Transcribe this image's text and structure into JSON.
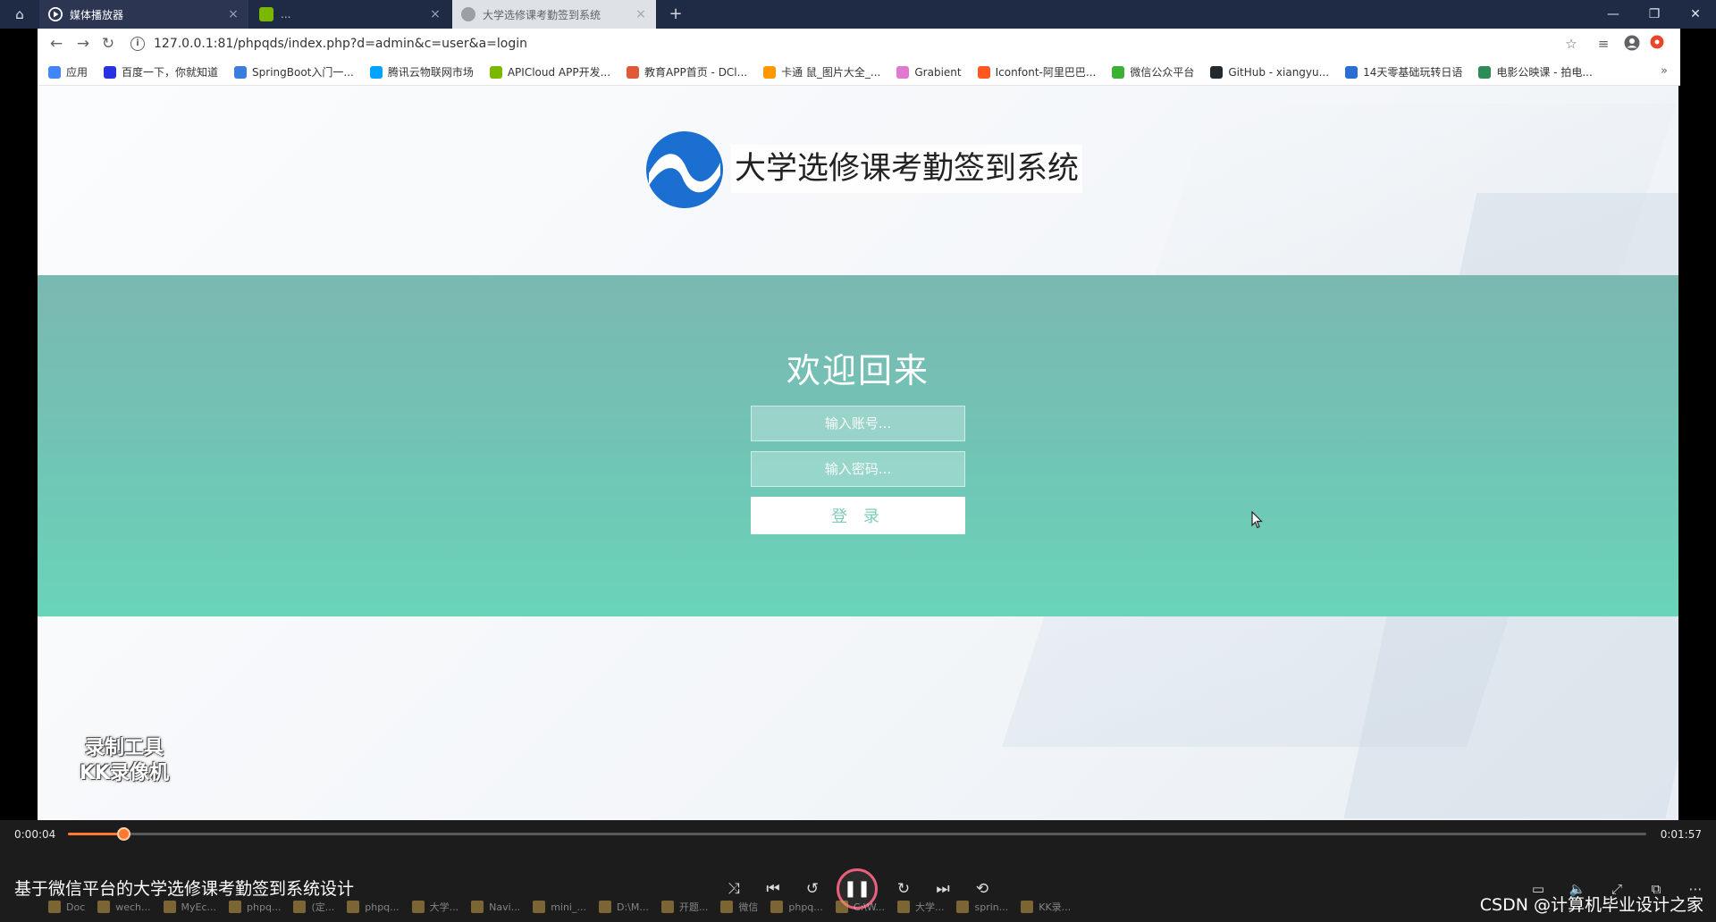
{
  "browser": {
    "tabs": [
      {
        "label": "媒体播放器",
        "active": false
      },
      {
        "label": "..."
      },
      {
        "label": "大学选修课考勤签到系统",
        "active": true
      }
    ],
    "address": "127.0.0.1:81/phpqds/index.php?d=admin&c=user&a=login",
    "bookmarks": [
      {
        "label": "应用",
        "color": "#4285f4"
      },
      {
        "label": "百度一下，你就知道",
        "color": "#2932e1"
      },
      {
        "label": "SpringBoot入门一...",
        "color": "#3b7ddd"
      },
      {
        "label": "腾讯云物联网市场",
        "color": "#00a4ff"
      },
      {
        "label": "APICloud APP开发...",
        "color": "#7ab800"
      },
      {
        "label": "教育APP首页 - DCl...",
        "color": "#e05a3a"
      },
      {
        "label": "卡通 鼠_图片大全_...",
        "color": "#ff9800"
      },
      {
        "label": "Grabient",
        "color": "#e07ad0"
      },
      {
        "label": "Iconfont-阿里巴巴...",
        "color": "#ff5722"
      },
      {
        "label": "微信公众平台",
        "color": "#3cb034"
      },
      {
        "label": "GitHub - xiangyu...",
        "color": "#24292e"
      },
      {
        "label": "14天零基础玩转日语",
        "color": "#2b6fd6"
      },
      {
        "label": "电影公映课 - 拍电...",
        "color": "#2e8b57"
      }
    ]
  },
  "page": {
    "site_title": "大学选修课考勤签到系统",
    "welcome": "欢迎回来",
    "account_placeholder": "输入账号...",
    "password_placeholder": "输入密码...",
    "login_label": "登 录",
    "watermark_line1": "录制工具",
    "watermark_line2": "KK录像机",
    "brand_color": "#1a6fd1",
    "banner_color": "#71c4b5"
  },
  "player": {
    "current_time": "0:00:04",
    "total_time": "0:01:57",
    "progress": 0.035,
    "title": "基于微信平台的大学选修课考勤签到系统设计",
    "accent_color": "#ff7a2e"
  },
  "taskbar": {
    "items": [
      "Doc",
      "wech...",
      "MyEc...",
      "phpq...",
      "(定...",
      "phpq...",
      "大学...",
      "Navi...",
      "mini_...",
      "D:\\M...",
      "开题...",
      "微信",
      "phpq...",
      "C:\\W...",
      "大学...",
      "sprin...",
      "KK录..."
    ],
    "watermark": "CSDN @计算机毕业设计之家"
  }
}
